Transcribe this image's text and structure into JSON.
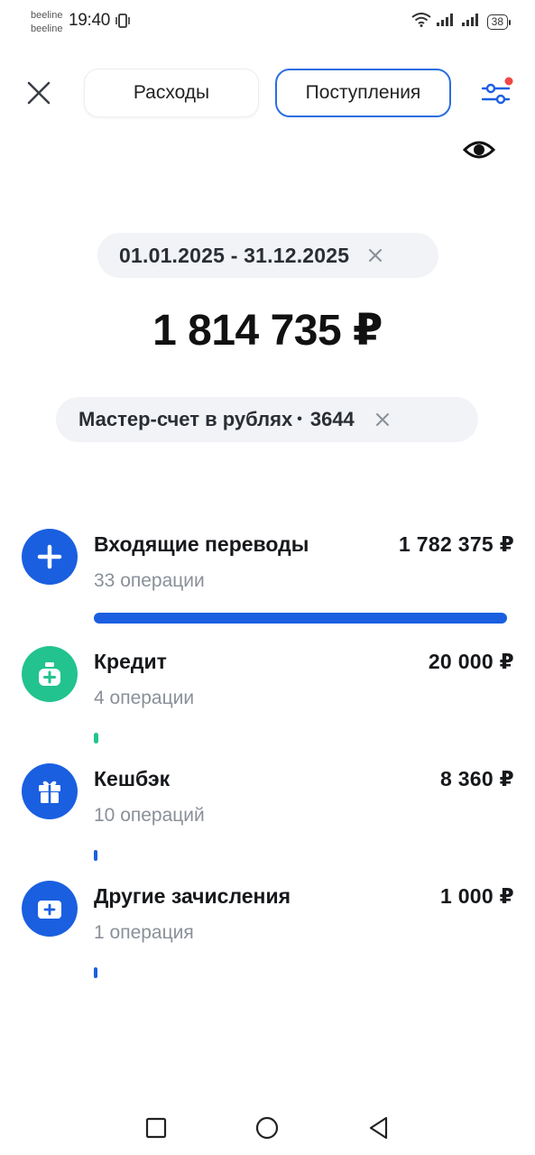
{
  "status_bar": {
    "carrier_1": "beeline",
    "carrier_2": "beeline",
    "time": "19:40",
    "battery": "38"
  },
  "tabs": [
    {
      "label": "Расходы",
      "active": false
    },
    {
      "label": "Поступления",
      "active": true
    }
  ],
  "filter": {
    "date_range": "01.01.2025 - 31.12.2025"
  },
  "total": "1 814 735 ₽",
  "account": {
    "name": "Мастер-счет в рублях",
    "separator": "•",
    "number": "3644"
  },
  "categories": [
    {
      "title": "Входящие переводы",
      "amount": "1 782 375 ₽",
      "operations": "33 операции",
      "share": 0.982,
      "color": "#1a5fe0",
      "icon": "plus-icon"
    },
    {
      "title": "Кредит",
      "amount": "20 000 ₽",
      "operations": "4 операции",
      "share": 0.011,
      "color": "#22c38e",
      "icon": "money-bag-icon"
    },
    {
      "title": "Кешбэк",
      "amount": "8 360 ₽",
      "operations": "10 операций",
      "share": 0.005,
      "color": "#1a5fe0",
      "icon": "gift-icon"
    },
    {
      "title": "Другие зачисления",
      "amount": "1 000 ₽",
      "operations": "1 операция",
      "share": 0.001,
      "color": "#1a5fe0",
      "icon": "wallet-plus-icon"
    }
  ],
  "colors": {
    "accent": "#1a5fe0",
    "credit": "#22c38e",
    "notification_dot": "#f04848"
  }
}
